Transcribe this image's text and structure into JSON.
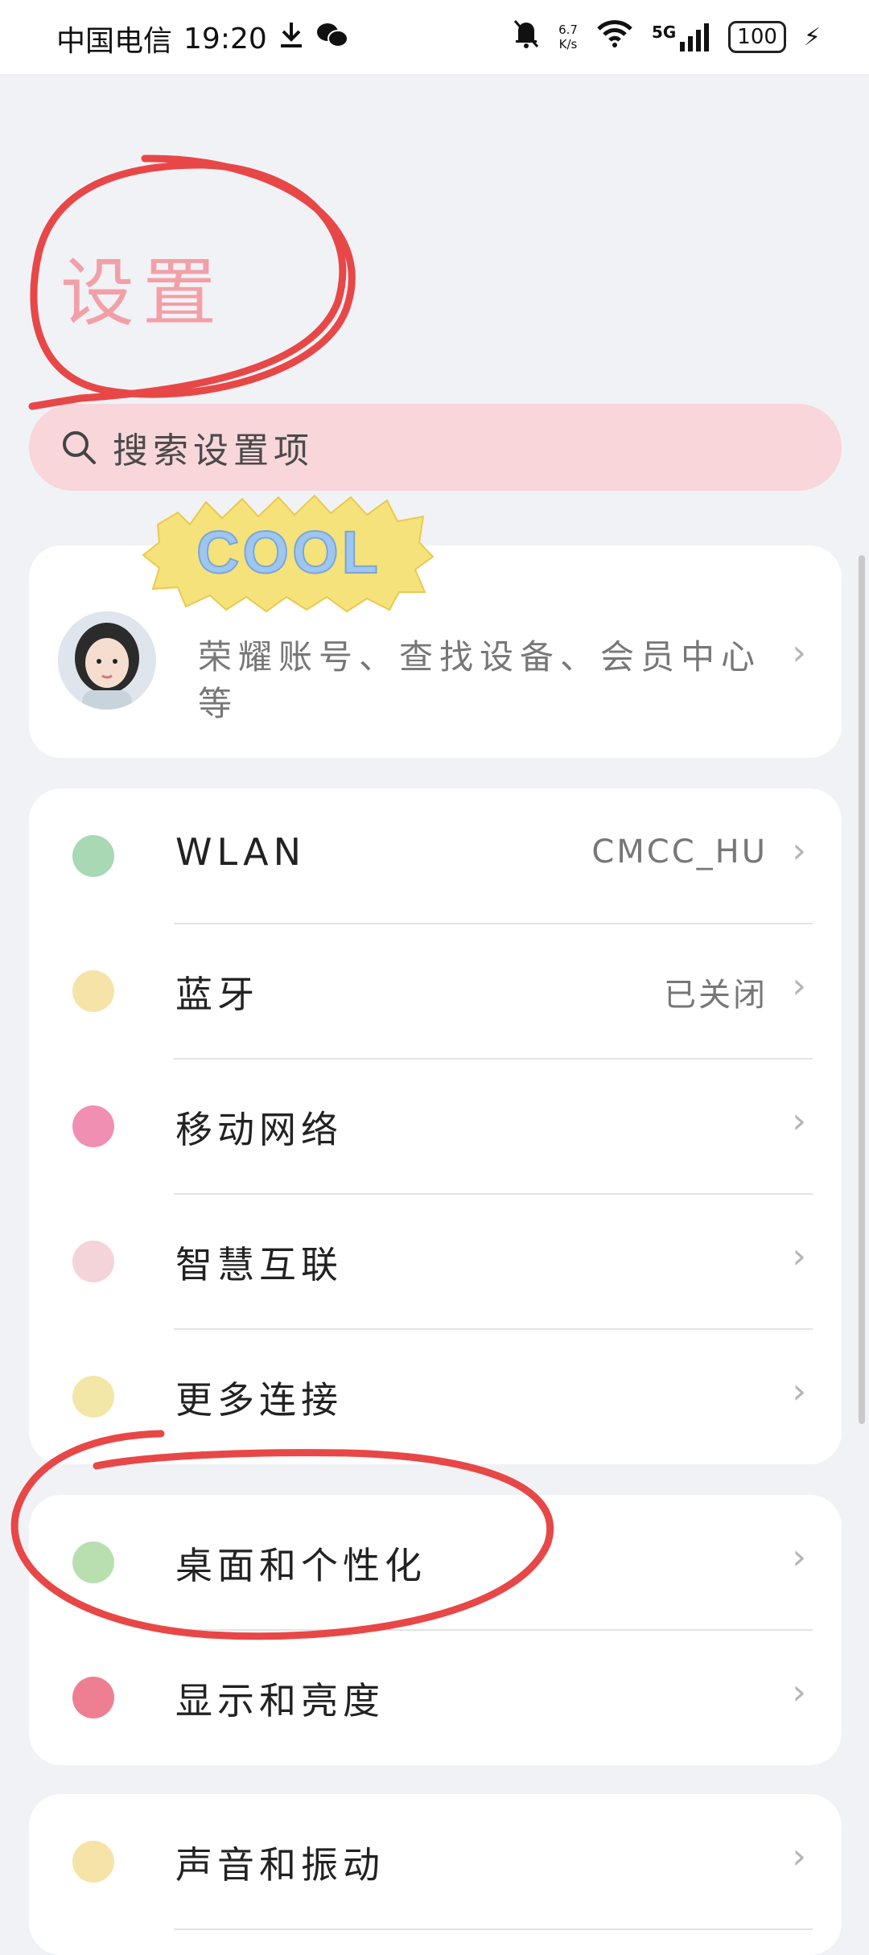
{
  "status_bar": {
    "carrier": "中国电信",
    "time": "19:20",
    "speed_value": "6.7",
    "speed_unit": "K/s",
    "network": "5G",
    "battery": "100"
  },
  "header": {
    "title": "设置"
  },
  "search": {
    "placeholder": "搜索设置项"
  },
  "account": {
    "sticker_text": "COOL",
    "description": "荣耀账号、查找设备、会员中心等"
  },
  "connectivity": [
    {
      "label": "WLAN",
      "value": "CMCC_HU",
      "icon": "wifi-sticker-icon",
      "color": "#a8d8b4"
    },
    {
      "label": "蓝牙",
      "value": "已关闭",
      "icon": "bluetooth-sticker-icon",
      "color": "#f6e3a8"
    },
    {
      "label": "移动网络",
      "value": "",
      "icon": "mobile-network-sticker-icon",
      "color": "#f08fb2"
    },
    {
      "label": "智慧互联",
      "value": "",
      "icon": "smart-link-sticker-icon",
      "color": "#f4d4d8"
    },
    {
      "label": "更多连接",
      "value": "",
      "icon": "more-connections-sticker-icon",
      "color": "#f3e7a8"
    }
  ],
  "display": [
    {
      "label": "桌面和个性化",
      "icon": "desktop-personalization-sticker-icon",
      "color": "#b9dfb0"
    },
    {
      "label": "显示和亮度",
      "icon": "display-brightness-sticker-icon",
      "color": "#ee7f93"
    }
  ],
  "sound": [
    {
      "label": "声音和振动",
      "icon": "sound-vibration-sticker-icon",
      "color": "#f6e3a8"
    }
  ],
  "colors": {
    "background": "#f1f2f6",
    "accent_pink": "#f2a0a8",
    "search_bg": "#f8d6da",
    "annotation_red": "#e84747"
  }
}
